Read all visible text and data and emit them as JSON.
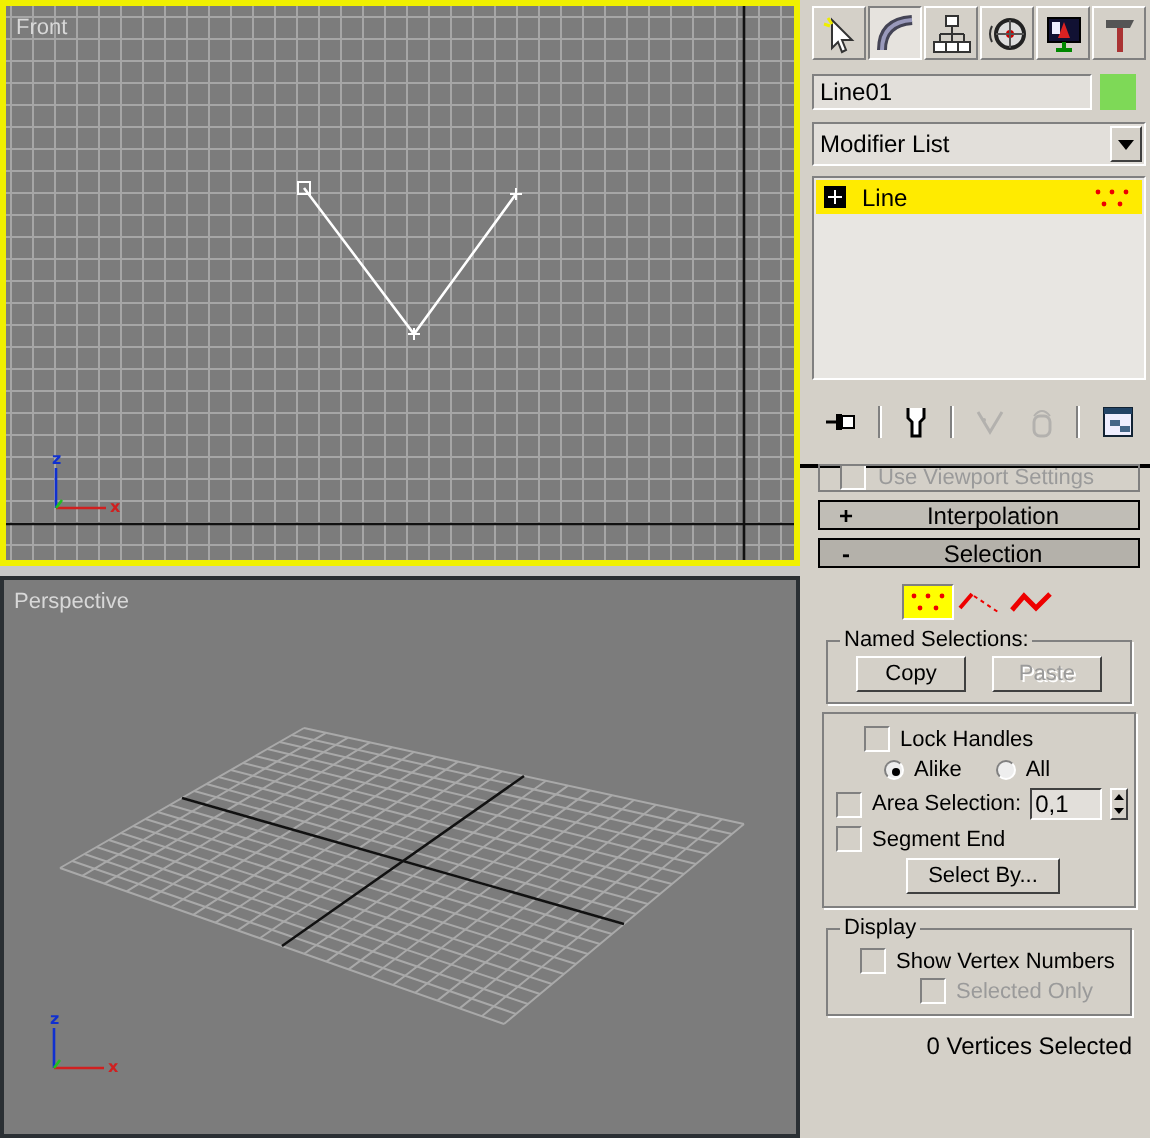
{
  "viewports": [
    {
      "kind": "front",
      "label": "Front",
      "active": true,
      "axis_labels": [
        "z",
        "x"
      ]
    },
    {
      "kind": "perspective",
      "label": "Perspective",
      "active": false,
      "axis_labels": [
        "z",
        "x"
      ]
    }
  ],
  "command_tabs": [
    {
      "selected": false
    },
    {
      "selected": true
    },
    {
      "selected": false
    },
    {
      "selected": false
    },
    {
      "selected": false
    },
    {
      "selected": false
    }
  ],
  "object_name": "Line01",
  "modifier_list": "Modifier List",
  "stack": [
    {
      "label": "Line",
      "selected": true,
      "expanded": false
    }
  ],
  "stack_tools": [
    {
      "disabled": false
    },
    {
      "disabled": false
    },
    {
      "disabled": true
    },
    {
      "disabled": true
    },
    {
      "disabled": false
    }
  ],
  "viewport_option": {
    "label": "Use Viewport Settings",
    "checked": false,
    "disabled": true
  },
  "rollouts": [
    {
      "sign": "+",
      "title": "Interpolation",
      "expanded": false
    },
    {
      "sign": "-",
      "title": "Selection",
      "expanded": true
    }
  ],
  "selection": {
    "levels": [
      {
        "selected": true
      },
      {
        "selected": false
      },
      {
        "selected": false
      }
    ],
    "named_title": "Named Selections:",
    "buttons": [
      {
        "label": "Copy",
        "disabled": false
      },
      {
        "label": "Paste",
        "disabled": true
      }
    ],
    "lock_handles": {
      "label": "Lock Handles",
      "checked": false
    },
    "radios": [
      {
        "label": "Alike",
        "selected": true
      },
      {
        "label": "All",
        "selected": false
      }
    ],
    "area_selection": {
      "label": "Area Selection:",
      "checked": false,
      "value": "0,1"
    },
    "segment_end": {
      "label": "Segment End",
      "checked": false
    },
    "select_by": "Select By...",
    "display": {
      "title": "Display",
      "options": [
        {
          "label": "Show Vertex Numbers",
          "checked": false,
          "disabled": false
        },
        {
          "label": "Selected Only",
          "checked": false,
          "disabled": true
        }
      ]
    },
    "status": "0 Vertices Selected"
  }
}
